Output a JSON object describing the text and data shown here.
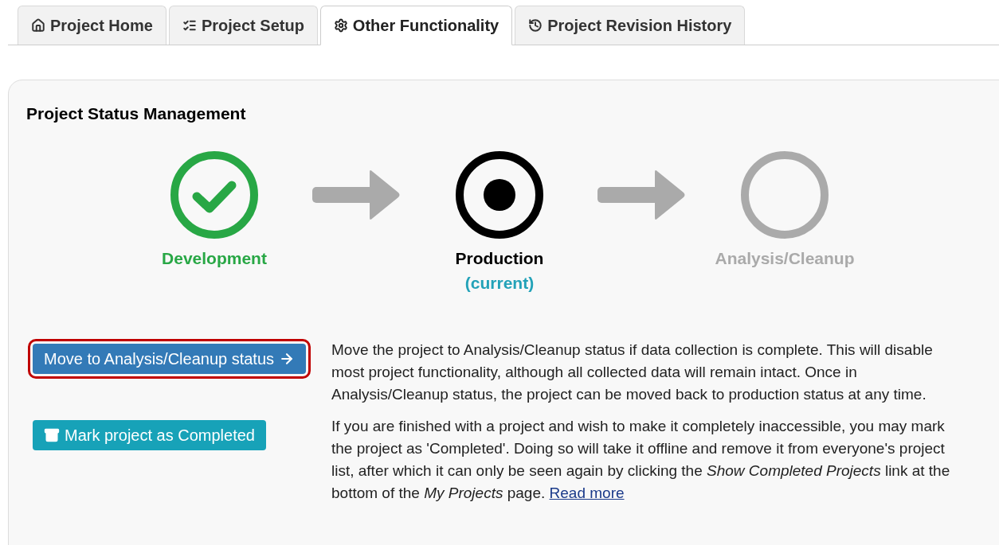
{
  "tabs": [
    {
      "label": "Project Home",
      "kind": "home",
      "selected": false
    },
    {
      "label": "Project Setup",
      "kind": "list",
      "selected": false
    },
    {
      "label": "Other Functionality",
      "kind": "gear",
      "selected": true
    },
    {
      "label": "Project Revision History",
      "kind": "history",
      "selected": false
    }
  ],
  "panel": {
    "title": "Project Status Management",
    "stages": [
      {
        "label": "Development",
        "kind": "done"
      },
      {
        "label": "Production",
        "kind": "current",
        "note": "(current)"
      },
      {
        "label": "Analysis/Cleanup",
        "kind": "pending"
      }
    ],
    "actions": [
      {
        "kind": "primary",
        "label": "Move to Analysis/Cleanup status",
        "highlighted": true,
        "description": "Move the project to Analysis/Cleanup status if data collection is complete. This will disable most project functionality, although all collected data will remain intact. Once in Analysis/Cleanup status, the project can be moved back to production status at any time."
      },
      {
        "kind": "info",
        "label": "Mark project as Completed",
        "highlighted": false,
        "description": "If you are finished with a project and wish to make it completely inaccessible, you may mark the project as 'Completed'. Doing so will take it offline and remove it from everyone's project list, after which it can only be seen again by clicking the *Show Completed Projects* link at the bottom of the *My Projects* page.",
        "link": "Read more"
      }
    ]
  }
}
